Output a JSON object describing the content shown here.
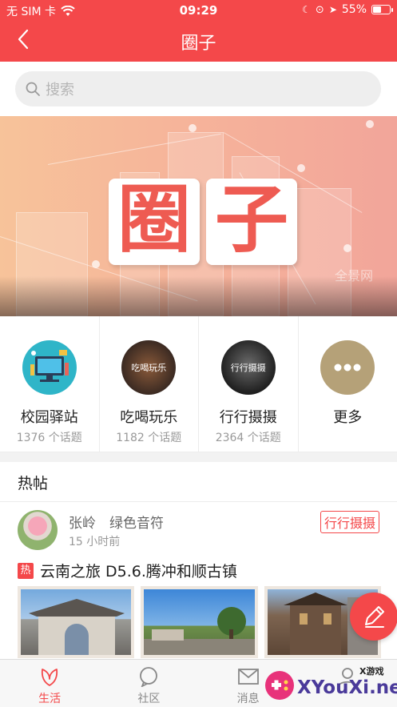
{
  "status_bar": {
    "carrier": "无 SIM 卡",
    "time": "09:29",
    "battery": "55%",
    "battery_level": 0.55
  },
  "nav": {
    "title": "圈子",
    "back_icon": "chevron-left-icon"
  },
  "search": {
    "placeholder": "搜索",
    "icon": "search-icon"
  },
  "banner": {
    "char1": "圈",
    "char2": "子",
    "watermark": "全景网"
  },
  "categories": [
    {
      "name": "校园驿站",
      "count": "1376 个话题",
      "image_label": ""
    },
    {
      "name": "吃喝玩乐",
      "count": "1182 个话题",
      "image_label": "吃喝玩乐"
    },
    {
      "name": "行行摄摄",
      "count": "2364 个话题",
      "image_label": "行行摄摄"
    },
    {
      "name": "更多",
      "count": "",
      "icon": "more-icon"
    }
  ],
  "hot": {
    "heading": "热帖",
    "post": {
      "author": "张岭　绿色音符",
      "time_ago": "15 小时前",
      "tag": "行行摄摄",
      "badge": "热",
      "title": "云南之旅 D5.6.腾冲和顺古镇"
    }
  },
  "tabs": [
    {
      "label": "生活",
      "icon": "leaf-icon",
      "active": true
    },
    {
      "label": "社区",
      "icon": "chat-bubble-icon",
      "active": false
    },
    {
      "label": "消息",
      "icon": "mail-icon",
      "active": false
    },
    {
      "label": "",
      "icon": "user-icon",
      "active": false
    }
  ],
  "watermark_brand": {
    "text": "XYouXi.net",
    "small": "X游戏"
  },
  "colors": {
    "primary": "#f4484a",
    "banner_text": "#ee5b52"
  }
}
